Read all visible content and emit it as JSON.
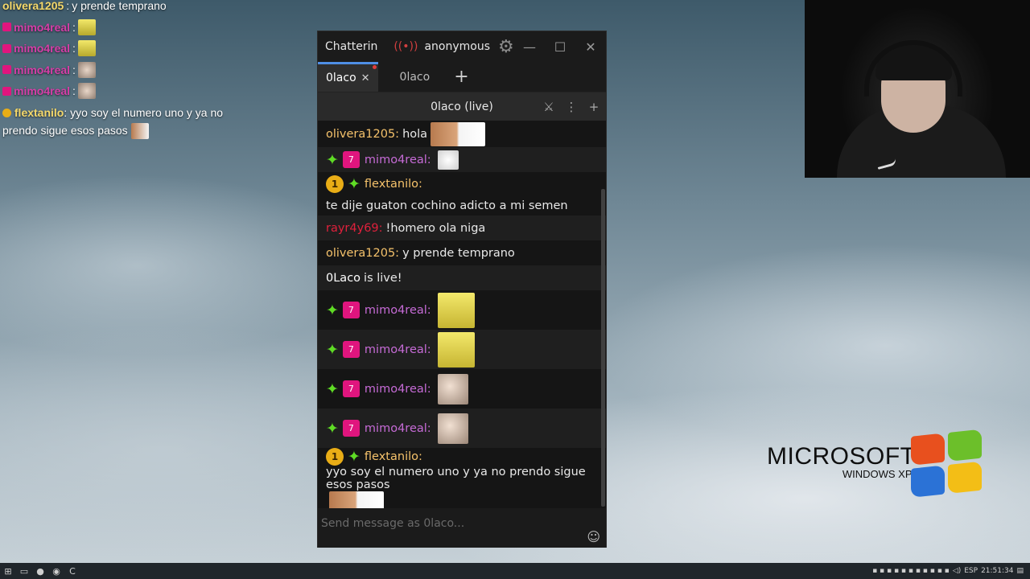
{
  "overlay": {
    "lines": [
      {
        "user": "olivera1205",
        "text": "y prende temprano"
      },
      {
        "user": "mimo4real"
      },
      {
        "user": "mimo4real"
      },
      {
        "user": "mimo4real"
      },
      {
        "user": "mimo4real"
      },
      {
        "user": "flextanilo",
        "text": "yyo soy el numero uno y ya no prendo sigue esos pasos"
      }
    ]
  },
  "window": {
    "app_title": "Chatterin",
    "account": "anonymous",
    "tabs": [
      {
        "label": "0laco",
        "active": true
      },
      {
        "label": "0laco",
        "active": false
      }
    ],
    "split_title": "0laco (live)",
    "input_placeholder": "Send message as 0laco..."
  },
  "messages": [
    {
      "user": "olivera1205",
      "user_color": "#f5c26b",
      "text": "hola",
      "emote": "bro-cat",
      "badges": []
    },
    {
      "user": "mimo4real",
      "user_color": "#c66bd6",
      "text": "",
      "emote": "white-cat",
      "badges": [
        "sparkle",
        "vip"
      ]
    },
    {
      "user": "flextanilo",
      "user_color": "#f5c26b",
      "text": "te dije guaton cochino adicto a mi semen",
      "badges": [
        "gold",
        "sparkle"
      ]
    },
    {
      "user": "rayr4y69",
      "user_color": "#e0203c",
      "text": "!homero ola niga",
      "badges": []
    },
    {
      "user": "olivera1205",
      "user_color": "#f5c26b",
      "text": "y prende temprano",
      "badges": []
    },
    {
      "user": "0Laco",
      "user_color": "#ffffff",
      "text": "is live!",
      "badges": [],
      "system": true
    },
    {
      "user": "mimo4real",
      "user_color": "#c66bd6",
      "text": "",
      "emote": "sponge",
      "badges": [
        "sparkle",
        "vip"
      ]
    },
    {
      "user": "mimo4real",
      "user_color": "#c66bd6",
      "text": "",
      "emote": "sponge",
      "badges": [
        "sparkle",
        "vip"
      ]
    },
    {
      "user": "mimo4real",
      "user_color": "#c66bd6",
      "text": "",
      "emote": "hamster",
      "badges": [
        "sparkle",
        "vip"
      ]
    },
    {
      "user": "mimo4real",
      "user_color": "#c66bd6",
      "text": "",
      "emote": "hamster",
      "badges": [
        "sparkle",
        "vip"
      ]
    },
    {
      "user": "flextanilo",
      "user_color": "#f5c26b",
      "text": "yyo soy el numero uno y ya no prendo sigue esos pasos",
      "emote": "bro-cat",
      "badges": [
        "gold",
        "sparkle"
      ]
    }
  ],
  "desktop_logo": {
    "line1": "MICROSOFT",
    "line2": "WINDOWS XP"
  },
  "taskbar": {
    "lang": "ESP",
    "clock": "21:51:34"
  },
  "colors": {
    "accent": "#4f8fe6",
    "vip": "#e0157e",
    "sparkle": "#5fdc25",
    "gold": "#e9ad16"
  }
}
